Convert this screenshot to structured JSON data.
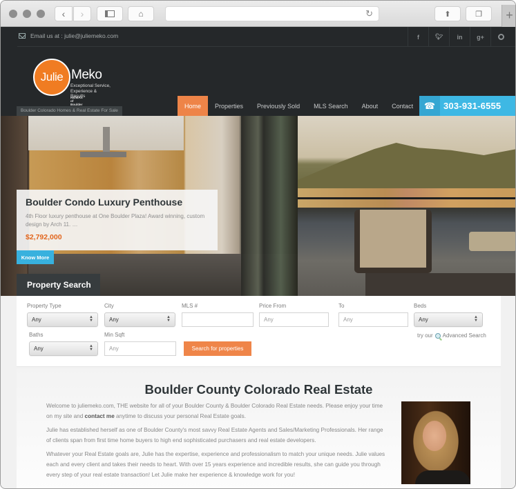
{
  "browser": {
    "url": "",
    "icons": [
      "back-icon",
      "forward-icon",
      "sidebar-icon",
      "home-icon",
      "reload-icon",
      "share-icon",
      "tabs-icon",
      "new-tab-icon"
    ]
  },
  "topbar": {
    "email_text": "Email us at : julie@juliemeko.com",
    "socials": [
      {
        "name": "facebook-icon",
        "glyph": "f"
      },
      {
        "name": "twitter-icon",
        "glyph": "t"
      },
      {
        "name": "linkedin-icon",
        "glyph": "in"
      },
      {
        "name": "google-plus-icon",
        "glyph": "g+"
      },
      {
        "name": "pinterest-icon",
        "glyph": "p"
      }
    ]
  },
  "logo": {
    "first": "Julie",
    "last": "Meko",
    "tagline1": "Exceptional Service,",
    "tagline2": "Experience & Results",
    "brokerage": "RE/MAX of Boulder"
  },
  "tagline_badge": "Boulder Colorado Homes & Real Estate For Sale",
  "nav": {
    "items": [
      "Home",
      "Properties",
      "Previously Sold",
      "MLS Search",
      "About",
      "Contact"
    ],
    "active": "Home",
    "phone": "303-931-6555"
  },
  "hero": {
    "listing_title": "Boulder Condo Luxury Penthouse",
    "listing_desc": "4th Floor luxury penthouse at One Boulder Plaza! Award winning, custom design by Arch 11. …",
    "listing_price": "$2,792,000",
    "know_more": "Know More",
    "search_tab": "Property Search"
  },
  "search": {
    "property_type": {
      "label": "Property Type",
      "value": "Any"
    },
    "city": {
      "label": "City",
      "value": "Any"
    },
    "mls": {
      "label": "MLS #",
      "value": "",
      "placeholder": ""
    },
    "price_from": {
      "label": "Price From",
      "placeholder": "Any"
    },
    "price_to": {
      "label": "To",
      "placeholder": "Any"
    },
    "beds": {
      "label": "Beds",
      "value": "Any"
    },
    "baths": {
      "label": "Baths",
      "value": "Any"
    },
    "min_sqft": {
      "label": "Min Sqft",
      "placeholder": "Any"
    },
    "submit": "Search for properties",
    "advanced_prefix": "try our",
    "advanced_link": "Advanced Search"
  },
  "content": {
    "title": "Boulder County Colorado Real Estate",
    "p1_a": "Welcome to juliemeko.com, THE website for all of your Boulder County & Boulder Colorado Real Estate needs. Please enjoy your time on my site and ",
    "p1_link": "contact me",
    "p1_b": " anytime to discuss your personal Real Estate goals.",
    "p2": "Julie has established herself as one of Boulder County's most savvy Real Estate Agents and Sales/Marketing Professionals. Her range of clients span from first time home buyers to high end sophisticated purchasers and real estate developers.",
    "p3": "Whatever your Real Estate goals are, Julie has the expertise, experience and professionalism to match your unique needs. Julie values each and every client and takes their needs to heart. With over 15 years experience and incredible results, she can guide you through every step of your real estate transaction! Let Julie make her experience & knowledge work for you!"
  },
  "colors": {
    "accent_orange": "#ee8448",
    "accent_blue": "#3eb8e4",
    "price_orange": "#e2651c",
    "header_dark": "#25282a"
  }
}
